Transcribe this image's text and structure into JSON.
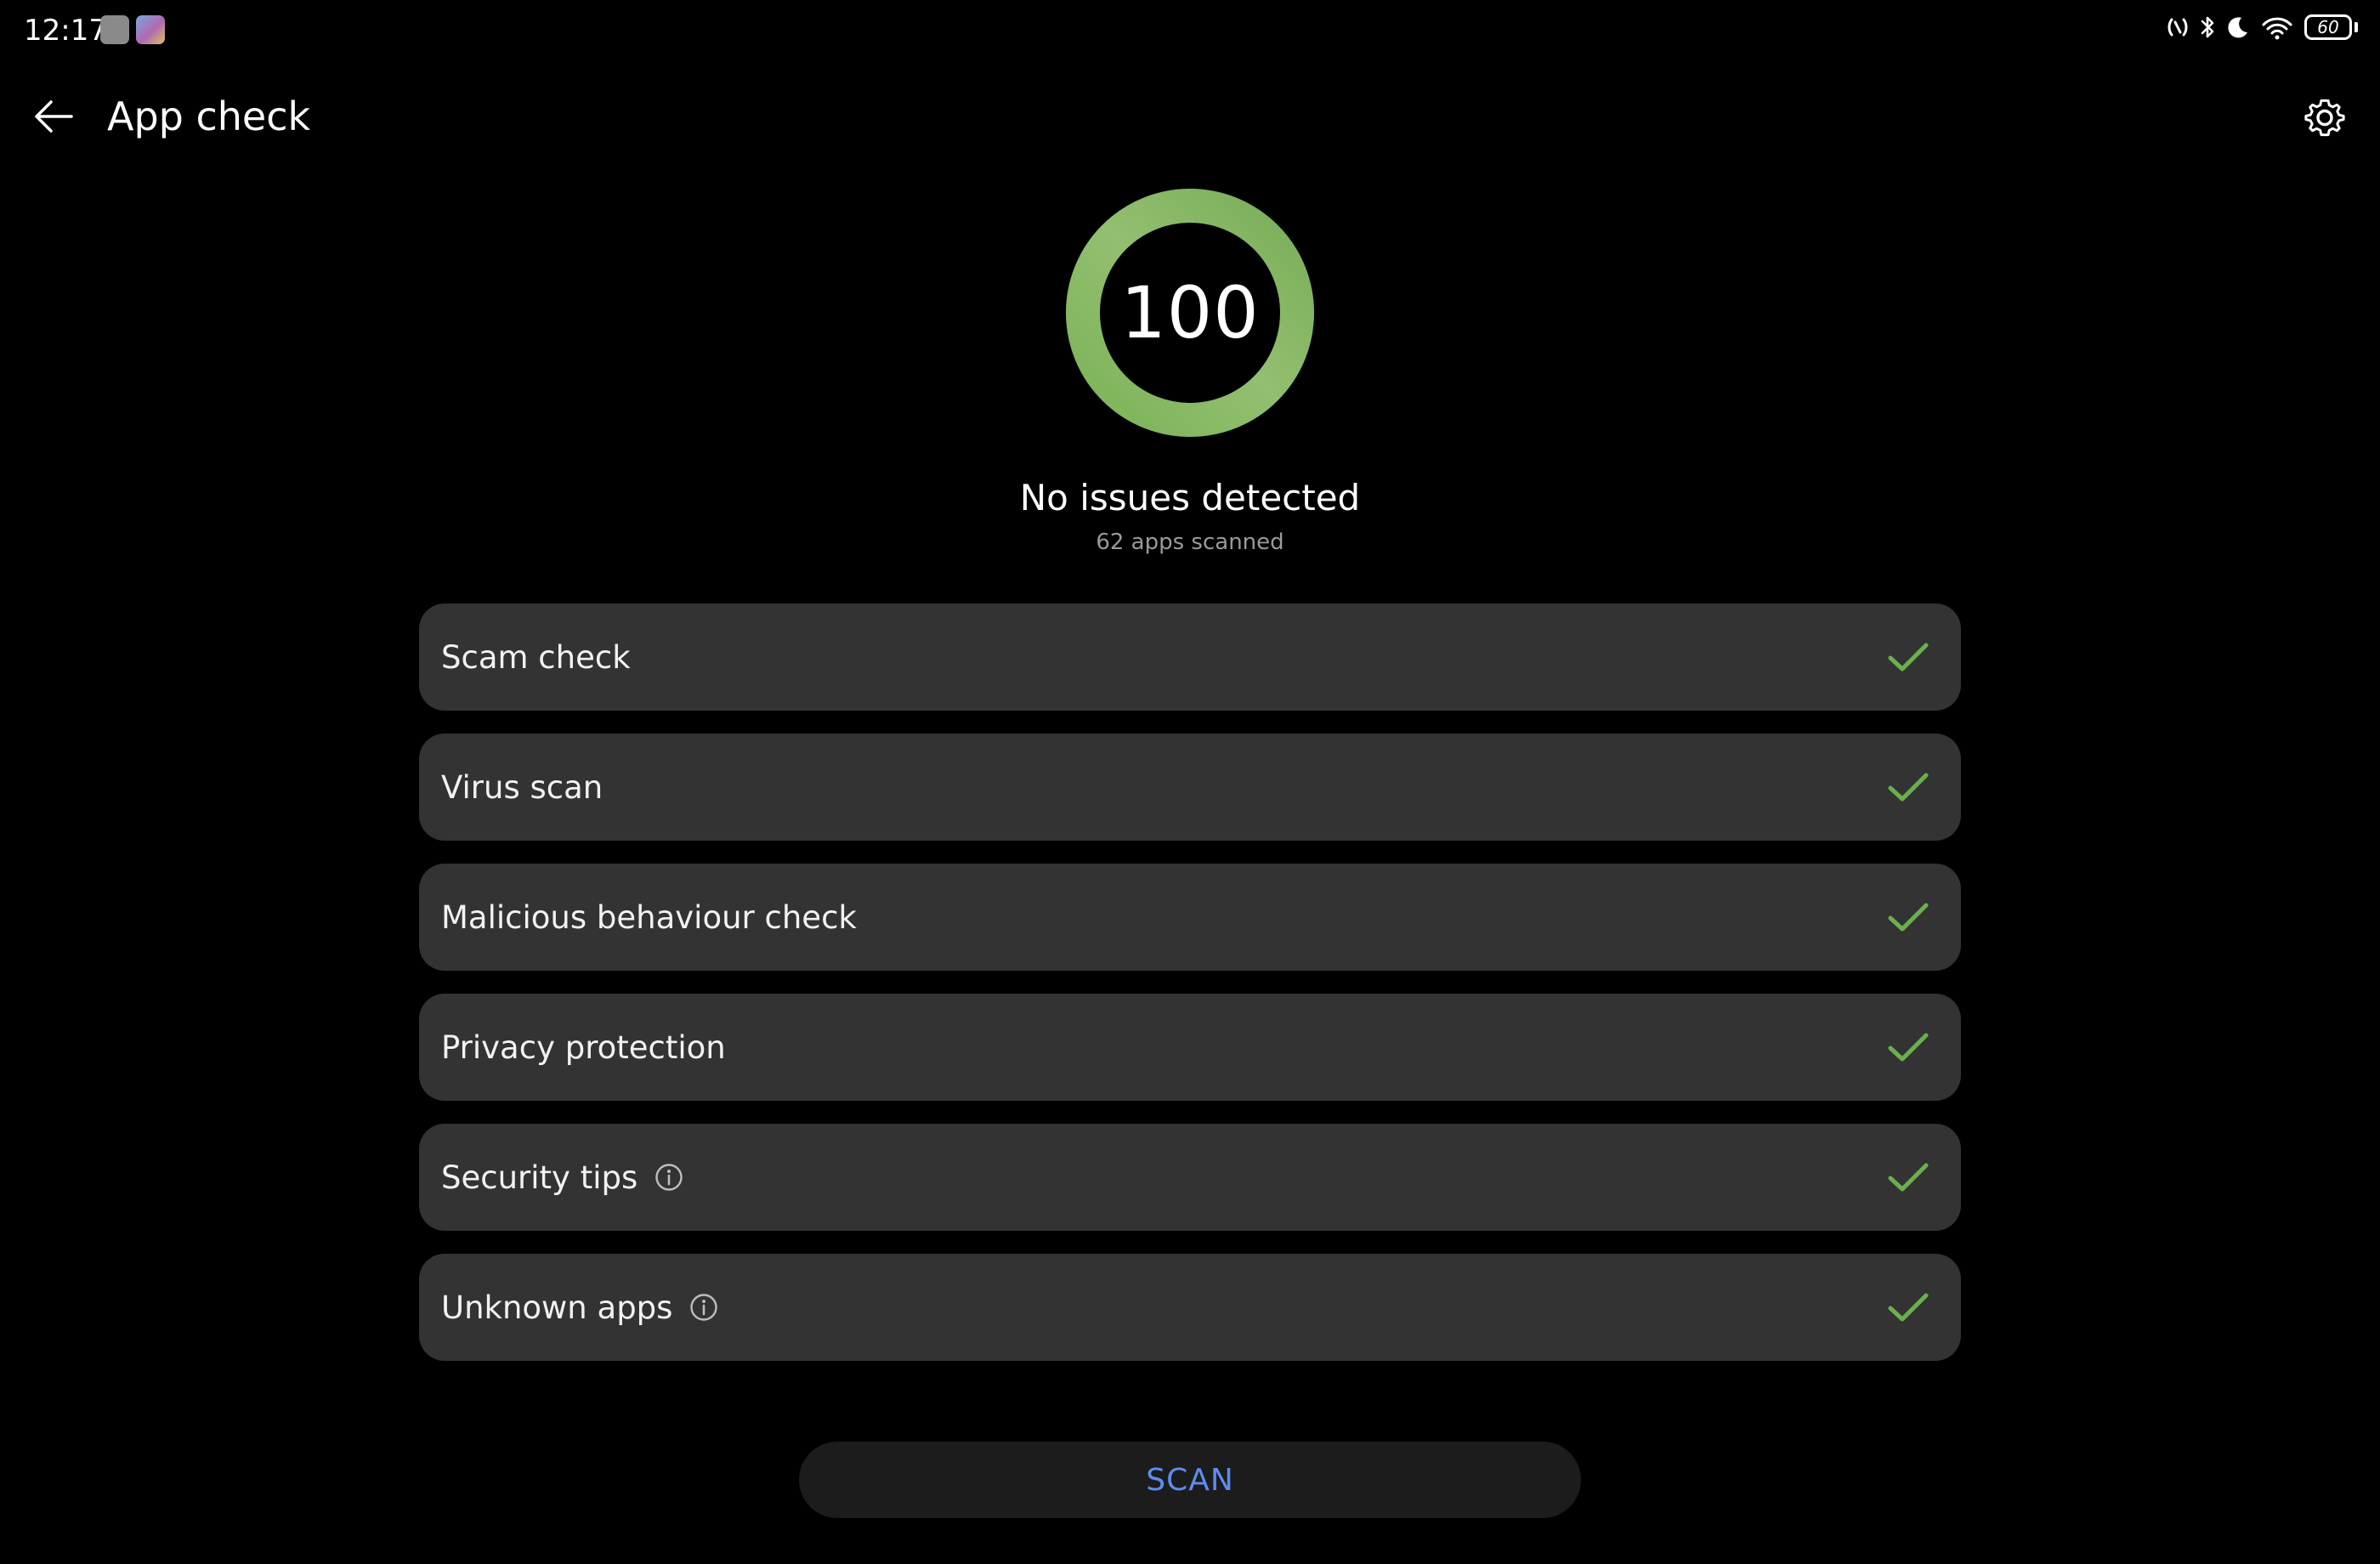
{
  "status_bar": {
    "time": "12:17",
    "battery_level": "60",
    "notification_icons": [
      "settings-app-icon",
      "gallery-app-icon"
    ],
    "system_icons": [
      "nfc-icon",
      "bluetooth-icon",
      "moon-icon",
      "wifi-icon",
      "battery-icon"
    ]
  },
  "header": {
    "title": "App check",
    "back_icon": "arrow-left-icon",
    "settings_icon": "gear-icon"
  },
  "score": {
    "value": "100",
    "progress_fraction": 1.0,
    "ring_color": "#86b667",
    "status": "No issues detected",
    "scanned": "62 apps scanned"
  },
  "checks": [
    {
      "label": "Scam check",
      "info": false,
      "status_icon": "checkmark-icon"
    },
    {
      "label": "Virus scan",
      "info": false,
      "status_icon": "checkmark-icon"
    },
    {
      "label": "Malicious behaviour check",
      "info": false,
      "status_icon": "checkmark-icon"
    },
    {
      "label": "Privacy protection",
      "info": false,
      "status_icon": "checkmark-icon"
    },
    {
      "label": "Security tips",
      "info": true,
      "status_icon": "checkmark-icon"
    },
    {
      "label": "Unknown apps",
      "info": true,
      "status_icon": "checkmark-icon"
    }
  ],
  "scan_button": {
    "label": "SCAN",
    "color": "#5f8cf0"
  },
  "colors": {
    "background": "#000000",
    "card": "#333333",
    "check_green": "#6ab04c"
  }
}
